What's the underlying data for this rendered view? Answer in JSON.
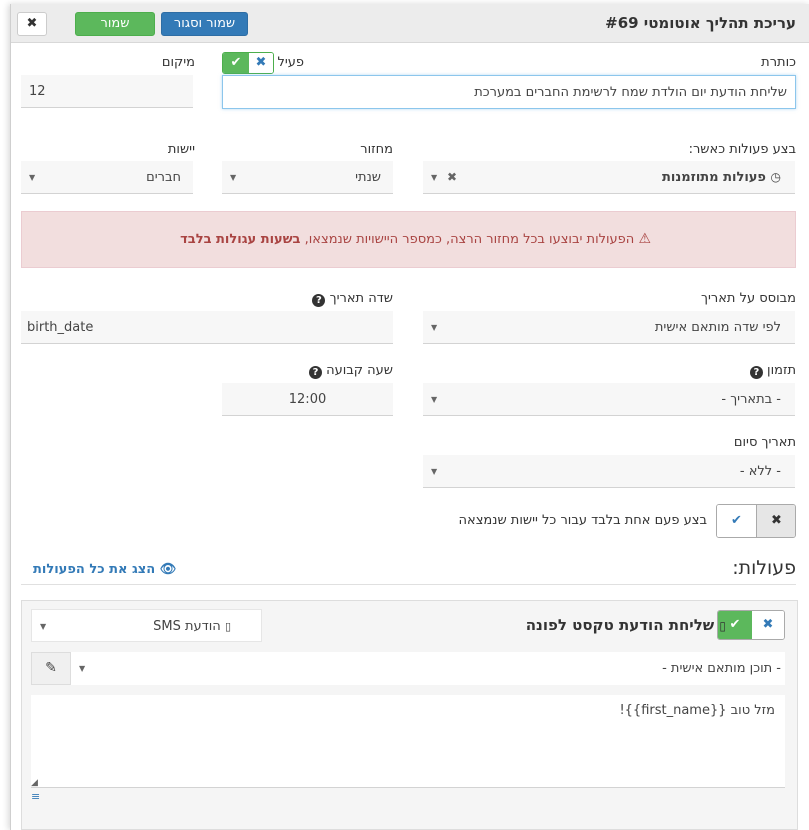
{
  "header": {
    "title": "עריכת תהליך אוטומטי #69",
    "save_close_label": "שמור וסגור",
    "save_label": "שמור",
    "close_glyph": "✖"
  },
  "form": {
    "title_label": "כותרת",
    "active_label": "פעיל",
    "title_value": "שליחת הודעת יום הולדת שמח לרשימת החברים במערכת",
    "position_label": "מיקום",
    "position_value": "12",
    "trigger_label": "בצע פעולות כאשר:",
    "trigger_value": "פעולות מתוזמנות",
    "cycle_label": "מחזור",
    "cycle_value": "שנתי",
    "entity_label": "יישות",
    "entity_value": "חברים",
    "alert_text": "הפעולות יבוצעו בכל מחזור הרצה, כמספר היישויות שנמצאו,",
    "alert_bold": "בשעות עגולות בלבד",
    "based_on_date_label": "מבוסס על תאריך",
    "based_on_date_value": "לפי שדה מותאם אישית",
    "date_field_label": "שדה תאריך",
    "date_field_value": "birth_date",
    "timing_label": "תזמון",
    "timing_value": "- בתאריך -",
    "fixed_hour_label": "שעה קבועה",
    "fixed_hour_value": "12:00",
    "end_date_label": "תאריך סיום",
    "end_date_value": "- ללא -",
    "once_label": "בצע פעם אחת בלבד עבור כל יישות שנמצאה"
  },
  "actions": {
    "heading": "פעולות:",
    "show_all_label": "הצג את כל הפעולות",
    "action_title": "שליחת הודעת טקסט לפונה",
    "action_type": "הודעת SMS",
    "content_select": "- תוכן מותאם אישית -",
    "message_text": "מזל טוב {{first_name}}!"
  },
  "colors": {
    "primary": "#337ab7",
    "success": "#5cb85c",
    "danger_bg": "#f2dede",
    "danger_text": "#a94442"
  }
}
